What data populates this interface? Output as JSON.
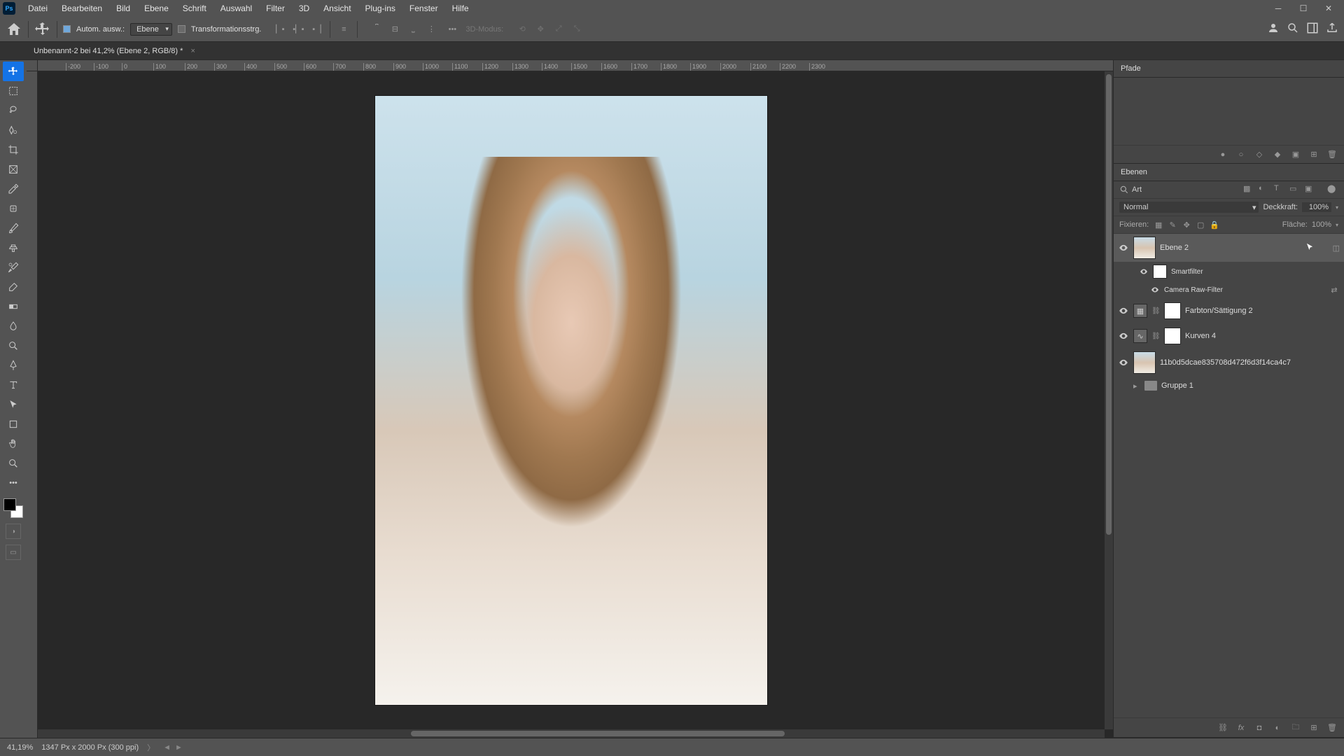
{
  "app_logo": "Ps",
  "menu": [
    "Datei",
    "Bearbeiten",
    "Bild",
    "Ebene",
    "Schrift",
    "Auswahl",
    "Filter",
    "3D",
    "Ansicht",
    "Plug-ins",
    "Fenster",
    "Hilfe"
  ],
  "options": {
    "auto_select_label": "Autom. ausw.:",
    "target_dropdown": "Ebene",
    "transform_label": "Transformationsstrg.",
    "mode_3d": "3D-Modus:"
  },
  "tab": {
    "title": "Unbenannt-2 bei 41,2% (Ebene 2, RGB/8) *"
  },
  "ruler_ticks": [
    "-200",
    "-100",
    "0",
    "100",
    "200",
    "300",
    "400",
    "500",
    "600",
    "700",
    "800",
    "900",
    "1000",
    "1100",
    "1200",
    "1300",
    "1400",
    "1500",
    "1600",
    "1700",
    "1800",
    "1900",
    "2000",
    "2100",
    "2200",
    "2300"
  ],
  "panels": {
    "paths": {
      "title": "Pfade"
    },
    "layers": {
      "title": "Ebenen",
      "filter_label": "Art",
      "blend_mode": "Normal",
      "opacity_label": "Deckkraft:",
      "opacity_value": "100%",
      "lock_label": "Fixieren:",
      "fill_label": "Fläche:",
      "fill_value": "100%",
      "items": [
        {
          "name": "Ebene 2",
          "type": "smart",
          "selected": true,
          "visible": true
        },
        {
          "name": "Smartfilter",
          "type": "sub-header",
          "indent": 1,
          "visible": true
        },
        {
          "name": "Camera Raw-Filter",
          "type": "sub-filter",
          "indent": 2,
          "visible": true
        },
        {
          "name": "Farbton/Sättigung 2",
          "type": "adjustment",
          "visible": true
        },
        {
          "name": "Kurven 4",
          "type": "adjustment",
          "visible": true
        },
        {
          "name": "11b0d5dcae835708d472f6d3f14ca4c7",
          "type": "image",
          "visible": true
        },
        {
          "name": "Gruppe 1",
          "type": "group",
          "visible": false
        }
      ]
    }
  },
  "status": {
    "zoom": "41,19%",
    "doc_info": "1347 Px x 2000 Px (300 ppi)"
  }
}
